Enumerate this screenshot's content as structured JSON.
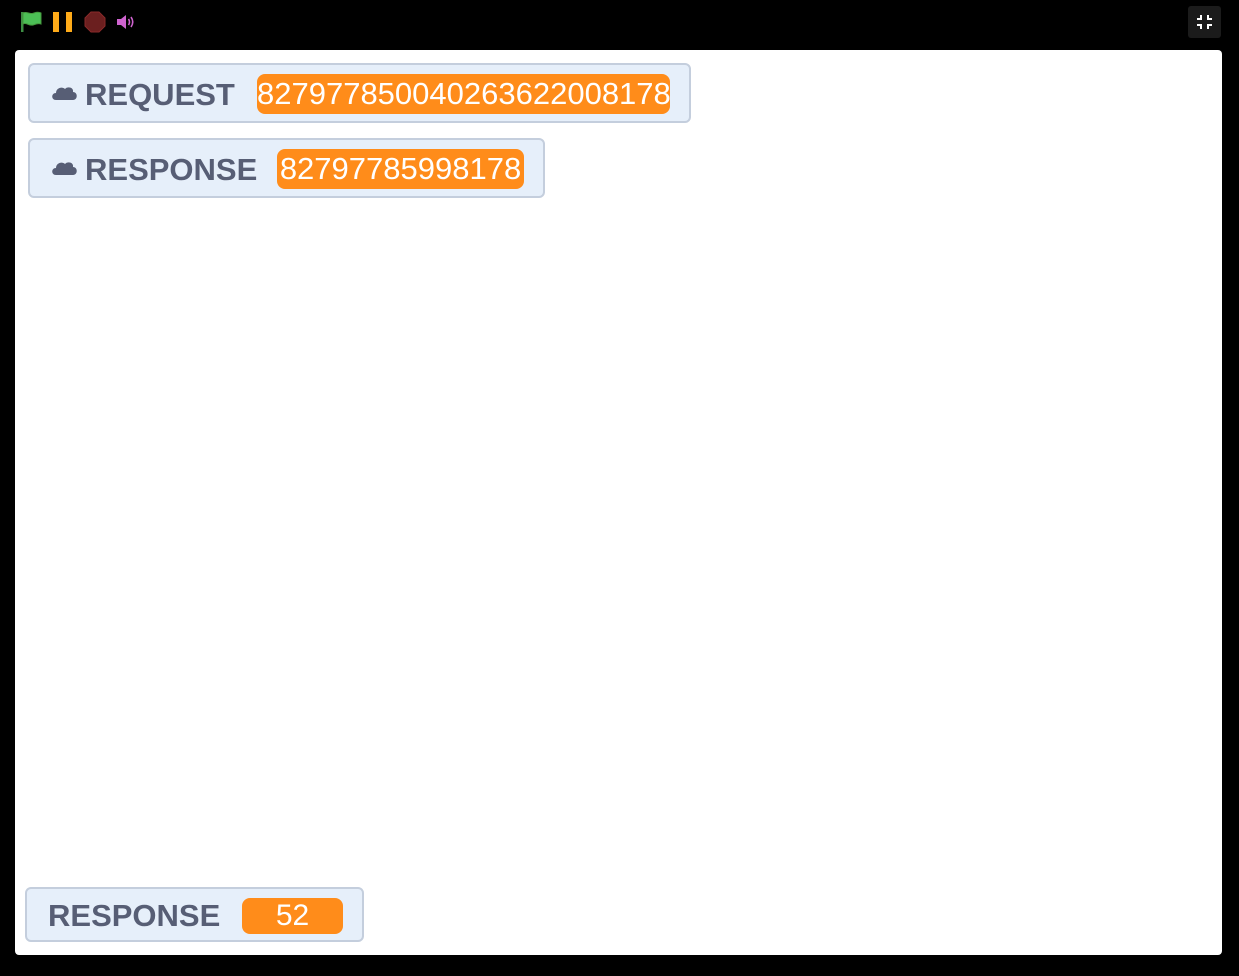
{
  "controls": {
    "green_flag_icon": "green-flag-icon",
    "pause_icon": "pause-icon",
    "stop_icon": "stop-icon",
    "sound_icon": "sound-icon",
    "exit_fullscreen_icon": "exit-fullscreen-icon"
  },
  "colors": {
    "background": "#000000",
    "stage": "#ffffff",
    "monitor_bg": "#e6effa",
    "monitor_border": "#c4cedd",
    "label": "#575e75",
    "value_bg": "#ff8c1a",
    "flag": "#4cbf56",
    "pause": "#ffab19",
    "stop": "#6b1f1f",
    "sound": "#cf63cf"
  },
  "monitors": [
    {
      "cloud": true,
      "label": "REQUEST",
      "value": "827977850040263622008178"
    },
    {
      "cloud": true,
      "label": "RESPONSE",
      "value": "82797785998178"
    },
    {
      "cloud": false,
      "label": "RESPONSE",
      "value": "52"
    }
  ]
}
